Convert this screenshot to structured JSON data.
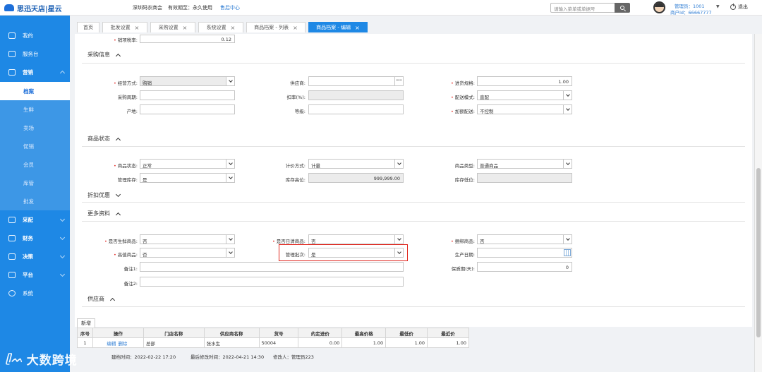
{
  "header": {
    "logo_text": "思迅天店|星云",
    "company": "深圳码农商会",
    "validity": "有效期至：永久使用",
    "after_sale": "售后中心",
    "search_placeholder": "请输入菜单或单据号",
    "user_role": "管理员：1001",
    "merchant_id": "商户Id：66667777",
    "logout_label": "退出"
  },
  "sidebar": {
    "items": [
      {
        "label": "我的"
      },
      {
        "label": "服务台"
      },
      {
        "label": "营销"
      },
      {
        "label": "采配"
      },
      {
        "label": "财务"
      },
      {
        "label": "决策"
      },
      {
        "label": "平台"
      },
      {
        "label": "系统"
      }
    ],
    "subitems": [
      {
        "label": "档案"
      },
      {
        "label": "生鲜"
      },
      {
        "label": "卖场"
      },
      {
        "label": "促销"
      },
      {
        "label": "会员"
      },
      {
        "label": "库管"
      },
      {
        "label": "批发"
      }
    ]
  },
  "tabs": [
    {
      "label": "首页"
    },
    {
      "label": "批发设置"
    },
    {
      "label": "采购设置"
    },
    {
      "label": "系统设置"
    },
    {
      "label": "商品档案 - 列表"
    },
    {
      "label": "商品档案 - 编辑"
    }
  ],
  "form": {
    "top_row": {
      "label": "销项税率:",
      "value": "0.12"
    },
    "purchase": {
      "title": "采购信息",
      "business_mode": {
        "label": "经营方式:",
        "value": "购销"
      },
      "supplier": {
        "label": "供应商:",
        "value": ""
      },
      "purchase_spec": {
        "label": "进货规格:",
        "value": "1.00"
      },
      "purchase_cycle": {
        "label": "采购周期:",
        "value": ""
      },
      "deduction": {
        "label": "扣率(%):",
        "value": ""
      },
      "delivery_mode": {
        "label": "配送模式:",
        "value": "直配"
      },
      "origin": {
        "label": "产地:",
        "value": ""
      },
      "grade": {
        "label": "等级:",
        "value": ""
      },
      "surcharge": {
        "label": "加额配送:",
        "value": "不控制"
      }
    },
    "status": {
      "title": "商品状态",
      "item_status": {
        "label": "商品状态:",
        "value": "正常"
      },
      "pricing": {
        "label": "计价方式:",
        "value": "计量"
      },
      "item_type": {
        "label": "商品类型:",
        "value": "普通商品"
      },
      "manage_stock": {
        "label": "管理库存:",
        "value": "是"
      },
      "stock_high": {
        "label": "库存高位:",
        "value": "999,999.00"
      },
      "stock_low": {
        "label": "库存低位:",
        "value": ""
      }
    },
    "discount": {
      "title": "折扣优惠"
    },
    "more": {
      "title": "更多资料",
      "is_fresh": {
        "label": "是否生鲜商品:",
        "value": "否"
      },
      "is_daily": {
        "label": "是否日清商品:",
        "value": "否"
      },
      "bundle": {
        "label": "捆绑商品:",
        "value": "否"
      },
      "is_luxury": {
        "label": "高值商品:",
        "value": "否"
      },
      "batch": {
        "label": "管理批次:",
        "value": "是"
      },
      "production_date": {
        "label": "生产日期:",
        "value": ""
      },
      "remark1": {
        "label": "备注1:",
        "value": ""
      },
      "shelf_life": {
        "label": "保质期(天):",
        "value": "0"
      },
      "remark2": {
        "label": "备注2:",
        "value": ""
      }
    },
    "suppliers": {
      "title": "供应商"
    }
  },
  "supplier_table": {
    "add_label": "新增",
    "headers": [
      "序号",
      "操作",
      "门店名称",
      "供应商名称",
      "货号",
      "约定进价",
      "最高价格",
      "最低价",
      "最近价"
    ],
    "rows": [
      {
        "no": "1",
        "edit": "编辑",
        "delete": "删除",
        "store": "总部",
        "supplier": "张水生",
        "code": "50004",
        "agreed_price": "0.00",
        "max_price": "1.00",
        "min_price": "1.00",
        "recent_price": "1.00"
      }
    ]
  },
  "footer": {
    "created": "建档时间：2022-02-22 17:20",
    "modified": "最后修改时间：2022-04-21 14:30",
    "modifier": "修改人：管理员223"
  },
  "watermark": "大数跨境"
}
